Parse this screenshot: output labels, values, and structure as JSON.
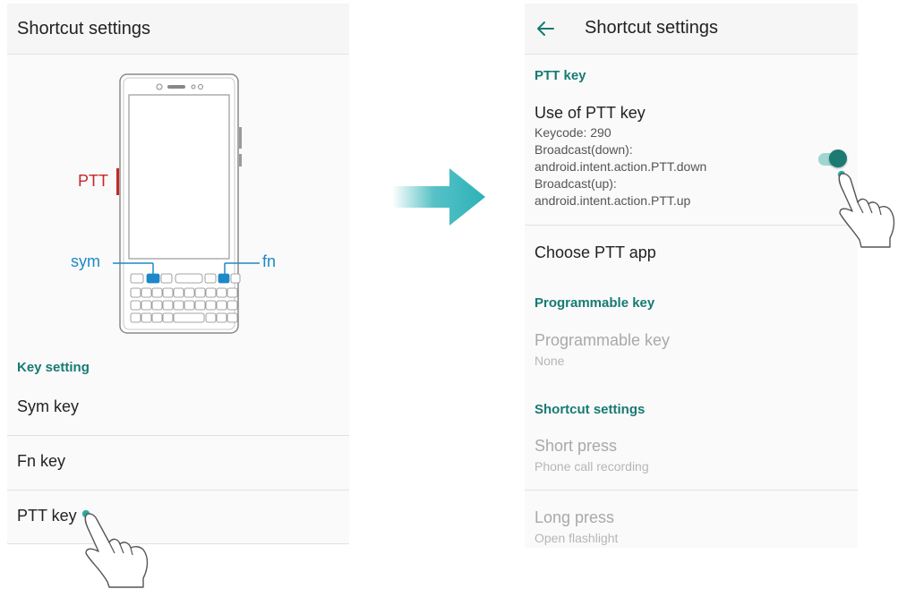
{
  "left": {
    "title": "Shortcut settings",
    "illustration_labels": {
      "ptt": "PTT",
      "sym": "sym",
      "fn": "fn"
    },
    "section_key_setting": "Key setting",
    "items": [
      {
        "label": "Sym key"
      },
      {
        "label": "Fn key"
      },
      {
        "label": "PTT key"
      }
    ]
  },
  "right": {
    "title": "Shortcut settings",
    "ptt_section": "PTT key",
    "use_ptt": {
      "title": "Use of PTT key",
      "keycode": "Keycode: 290",
      "broadcast_down_label": "Broadcast(down):",
      "broadcast_down_value": "android.intent.action.PTT.down",
      "broadcast_up_label": "Broadcast(up):",
      "broadcast_up_value": "android.intent.action.PTT.up",
      "enabled": true
    },
    "choose_ptt_app": "Choose PTT app",
    "programmable_section": "Programmable key",
    "programmable_item": {
      "title": "Programmable key",
      "value": "None"
    },
    "shortcut_section": "Shortcut settings",
    "short_press": {
      "title": "Short press",
      "value": "Phone call recording"
    },
    "long_press": {
      "title": "Long press",
      "value": "Open flashlight"
    }
  },
  "colors": {
    "accent": "#167a73",
    "ptt_label": "#c62828",
    "callout": "#1e88c8",
    "arrow": "#2cb2b8"
  },
  "icons": [
    "back-arrow-icon",
    "tap-hand-icon",
    "transition-arrow-icon",
    "phone-illustration"
  ]
}
